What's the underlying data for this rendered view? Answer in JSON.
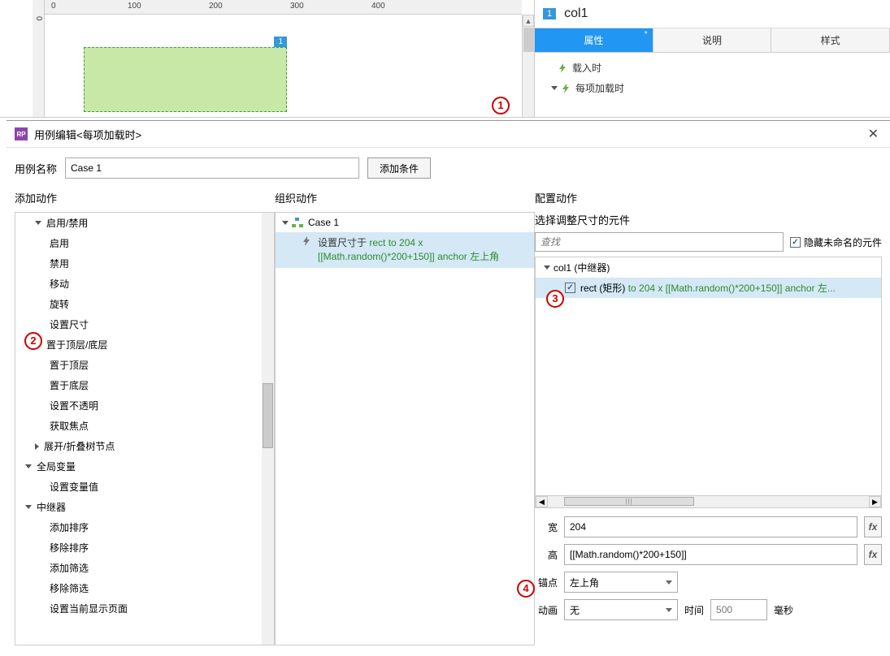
{
  "ruler": {
    "h": [
      "0",
      "100",
      "200",
      "300",
      "400"
    ],
    "v": [
      "0"
    ]
  },
  "canvas": {
    "widget_badge": "1"
  },
  "inspector": {
    "num": "1",
    "name": "col1",
    "tabs": [
      "属性",
      "说明",
      "样式"
    ],
    "events": {
      "onload": "载入时",
      "onitemload": "每项加载时"
    }
  },
  "dialog": {
    "title": "用例编辑<每项加载时>",
    "case_label": "用例名称",
    "case_name": "Case 1",
    "add_condition": "添加条件",
    "col_add": "添加动作",
    "col_org": "组织动作",
    "col_cfg": "配置动作"
  },
  "actions": {
    "enable_disable": "启用/禁用",
    "enable": "启用",
    "disable": "禁用",
    "move": "移动",
    "rotate": "旋转",
    "set_size": "设置尺寸",
    "bring_front_back": "置于顶层/底层",
    "bring_front": "置于顶层",
    "send_back": "置于底层",
    "set_opacity": "设置不透明",
    "focus": "获取焦点",
    "expand_collapse": "展开/折叠树节点",
    "globals": "全局变量",
    "set_var": "设置变量值",
    "repeater": "中继器",
    "add_sort": "添加排序",
    "remove_sort": "移除排序",
    "add_filter": "添加筛选",
    "remove_filter": "移除筛选",
    "set_page": "设置当前显示页面"
  },
  "org": {
    "case": "Case 1",
    "action_prefix": "设置尺寸于",
    "action_detail": "rect to 204 x [[Math.random()*200+150]] anchor 左上角"
  },
  "config": {
    "title": "选择调整尺寸的元件",
    "search_placeholder": "查找",
    "hide_unnamed": "隐藏未命名的元件",
    "tree_parent": "col1 (中继器)",
    "tree_child_name": "rect (矩形)",
    "tree_child_detail": "to 204 x [[Math.random()*200+150]] anchor 左...",
    "width_label": "宽",
    "width_value": "204",
    "height_label": "高",
    "height_value": "[[Math.random()*200+150]]",
    "anchor_label": "锚点",
    "anchor_value": "左上角",
    "anim_label": "动画",
    "anim_value": "无",
    "time_label": "时间",
    "time_placeholder": "500",
    "time_unit": "毫秒"
  },
  "markers": {
    "m1": "1",
    "m2": "2",
    "m3": "3",
    "m4": "4"
  }
}
